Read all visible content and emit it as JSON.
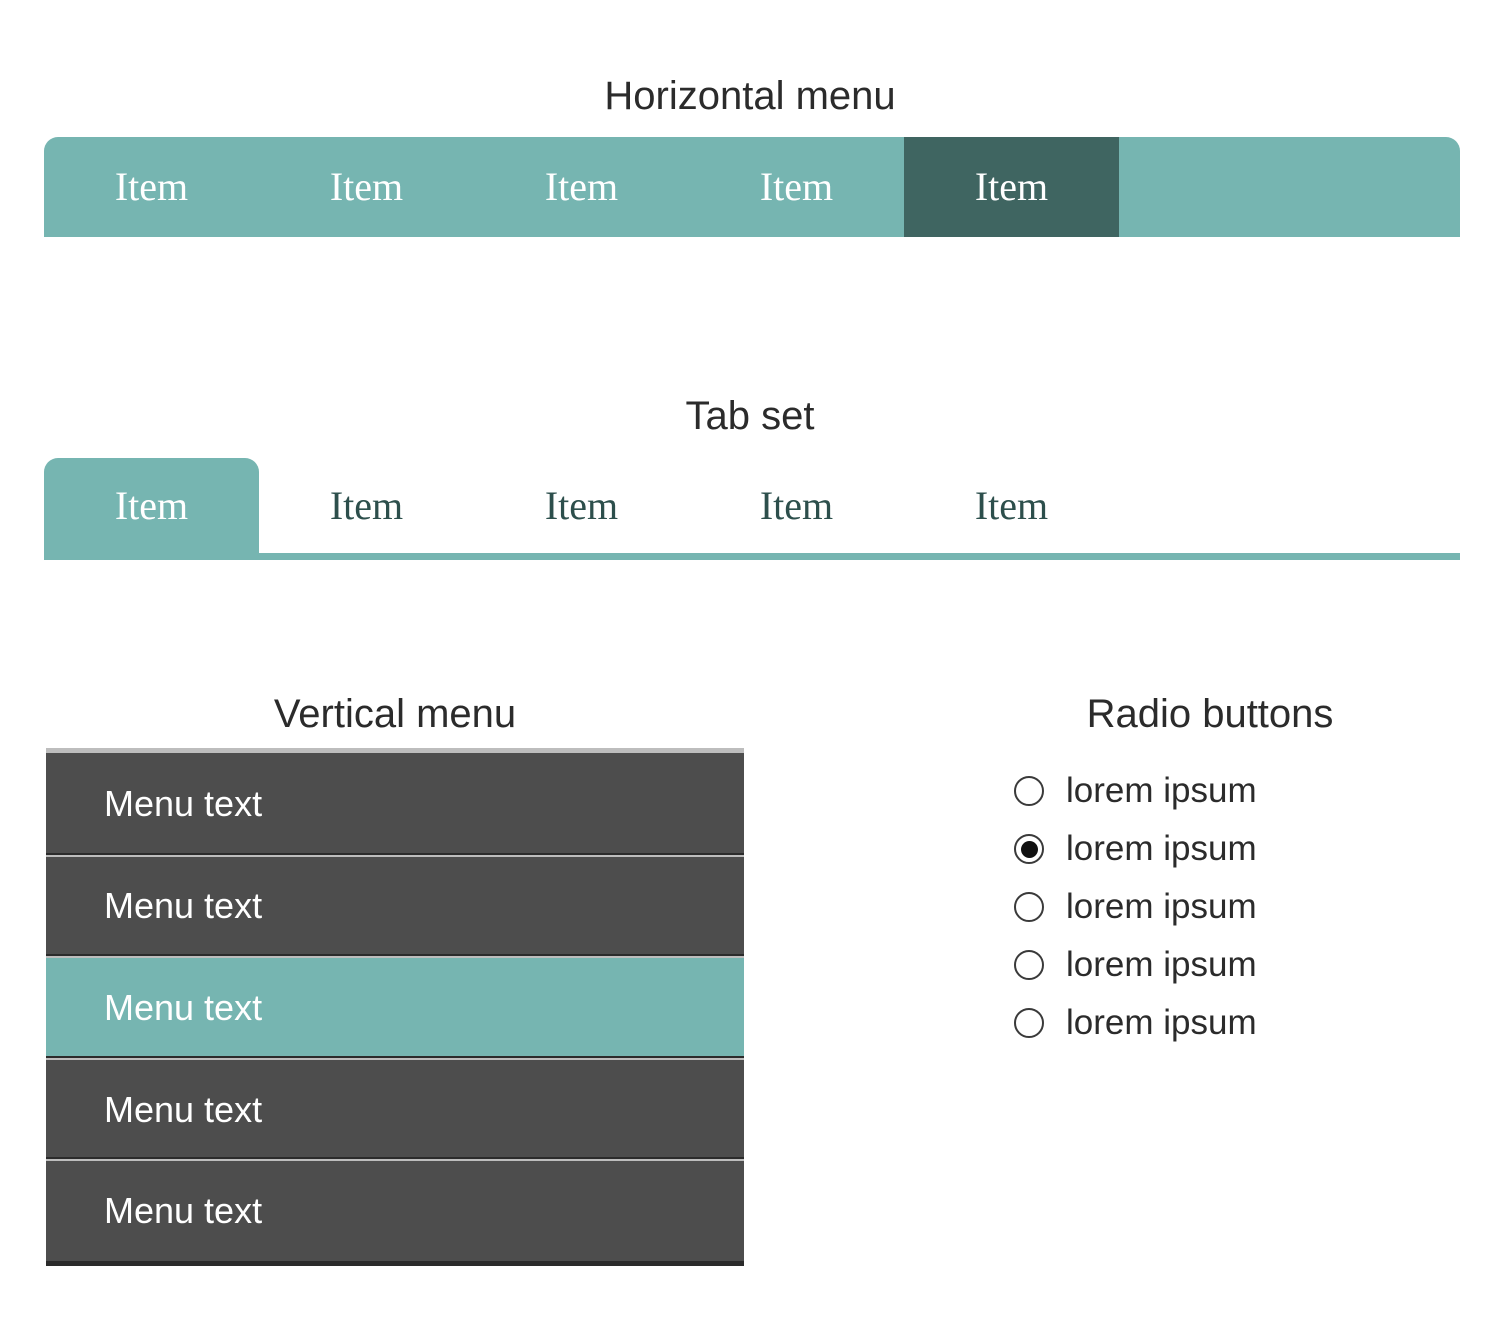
{
  "sections": {
    "horizontal_menu": {
      "title": "Horizontal menu",
      "items": [
        {
          "label": "Item",
          "active": false
        },
        {
          "label": "Item",
          "active": false
        },
        {
          "label": "Item",
          "active": false
        },
        {
          "label": "Item",
          "active": false
        },
        {
          "label": "Item",
          "active": true
        }
      ],
      "colors": {
        "bar": "#76b5b1",
        "active_item": "#3f6561",
        "text": "#ffffff"
      }
    },
    "tab_set": {
      "title": "Tab set",
      "tabs": [
        {
          "label": "Item",
          "active": true
        },
        {
          "label": "Item",
          "active": false
        },
        {
          "label": "Item",
          "active": false
        },
        {
          "label": "Item",
          "active": false
        },
        {
          "label": "Item",
          "active": false
        }
      ],
      "colors": {
        "active_tab": "#76b5b1",
        "active_text": "#ffffff",
        "inactive_text": "#2d4f4c",
        "underline": "#76b5b1"
      }
    },
    "vertical_menu": {
      "title": "Vertical menu",
      "items": [
        {
          "label": "Menu text",
          "active": false
        },
        {
          "label": "Menu text",
          "active": false
        },
        {
          "label": "Menu text",
          "active": true
        },
        {
          "label": "Menu text",
          "active": false
        },
        {
          "label": "Menu text",
          "active": false
        }
      ],
      "colors": {
        "item": "#4d4d4d",
        "active_item": "#76b5b1",
        "text": "#ffffff",
        "separator": "#bdbdbd",
        "border": "#2b2b2b"
      }
    },
    "radio_buttons": {
      "title": "Radio buttons",
      "options": [
        {
          "label": "lorem ipsum",
          "selected": false
        },
        {
          "label": "lorem ipsum",
          "selected": true
        },
        {
          "label": "lorem ipsum",
          "selected": false
        },
        {
          "label": "lorem ipsum",
          "selected": false
        },
        {
          "label": "lorem ipsum",
          "selected": false
        }
      ],
      "colors": {
        "ring": "#3a3a3a",
        "dot": "#111111",
        "text": "#2b2b2b"
      }
    }
  }
}
